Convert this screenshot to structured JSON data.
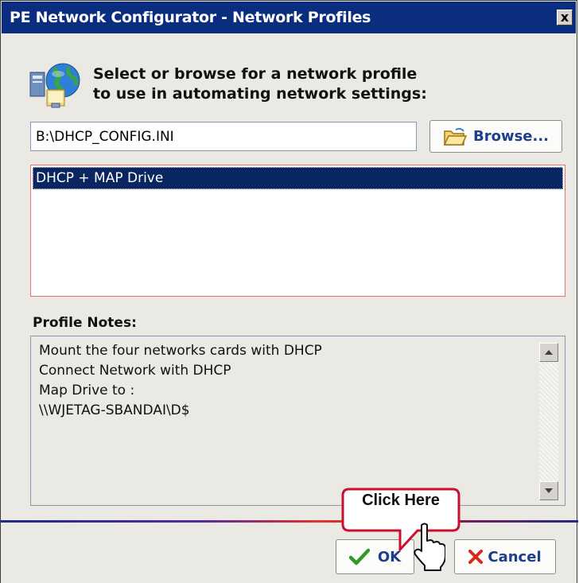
{
  "window": {
    "title": "PE Network Configurator - Network Profiles",
    "close_label": "x"
  },
  "header": {
    "instruction_line1": "Select or browse for a network profile",
    "instruction_line2": "to use in automating network settings:"
  },
  "profile_path": {
    "value": "B:\\DHCP_CONFIG.INI"
  },
  "browse_button": {
    "label": "Browse..."
  },
  "profiles": {
    "items": [
      {
        "label": "DHCP + MAP Drive",
        "selected": true
      }
    ]
  },
  "notes": {
    "label": "Profile Notes:",
    "lines": [
      "Mount the four networks cards with DHCP",
      "Connect Network with DHCP",
      "Map Drive to :",
      "\\\\WJETAG-SBANDAI\\D$"
    ]
  },
  "buttons": {
    "ok_label": "OK",
    "cancel_label": "Cancel"
  },
  "callout": {
    "text": "Click Here"
  },
  "colors": {
    "titlebar": "#0a2d7f",
    "dialog_bg": "#ebe9e4",
    "selection": "#0a2660",
    "callout_border": "#c8102e",
    "button_text": "#1d3e8a"
  },
  "icons": {
    "header": "network-globe-icon",
    "browse": "folder-open-icon",
    "ok": "checkmark-icon",
    "cancel": "x-mark-icon"
  }
}
